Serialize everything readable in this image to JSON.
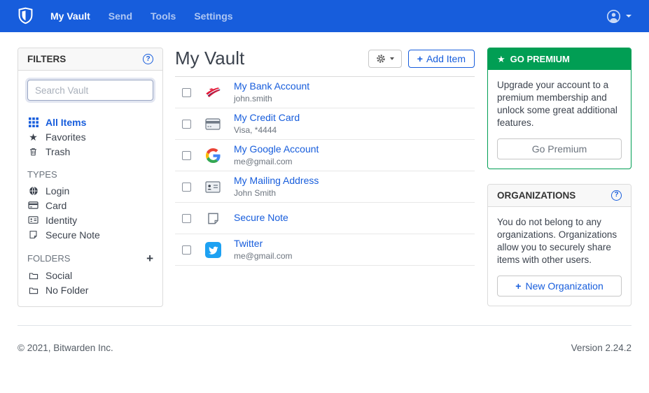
{
  "navbar": {
    "items": [
      {
        "label": "My Vault",
        "active": true
      },
      {
        "label": "Send",
        "active": false
      },
      {
        "label": "Tools",
        "active": false
      },
      {
        "label": "Settings",
        "active": false
      }
    ]
  },
  "icons": {
    "plus": "+",
    "star": "★",
    "question_mark": "?"
  },
  "filters": {
    "title": "FILTERS",
    "search_placeholder": "Search Vault",
    "items": [
      {
        "label": "All Items",
        "active": true
      },
      {
        "label": "Favorites",
        "active": false
      },
      {
        "label": "Trash",
        "active": false
      }
    ],
    "types_heading": "TYPES",
    "types": [
      {
        "label": "Login"
      },
      {
        "label": "Card"
      },
      {
        "label": "Identity"
      },
      {
        "label": "Secure Note"
      }
    ],
    "folders_heading": "FOLDERS",
    "folders": [
      {
        "label": "Social"
      },
      {
        "label": "No Folder"
      }
    ]
  },
  "vault": {
    "title": "My Vault",
    "add_item_label": "Add Item",
    "items": [
      {
        "title": "My Bank Account",
        "subtitle": "john.smith",
        "icon": "bank-of-america"
      },
      {
        "title": "My Credit Card",
        "subtitle": "Visa, *4444",
        "icon": "credit-card"
      },
      {
        "title": "My Google Account",
        "subtitle": "me@gmail.com",
        "icon": "google"
      },
      {
        "title": "My Mailing Address",
        "subtitle": "John Smith",
        "icon": "identity-card"
      },
      {
        "title": "Secure Note",
        "subtitle": "",
        "icon": "secure-note"
      },
      {
        "title": "Twitter",
        "subtitle": "me@gmail.com",
        "icon": "twitter"
      }
    ]
  },
  "premium": {
    "title": "GO PREMIUM",
    "body": "Upgrade your account to a premium membership and unlock some great additional features.",
    "button_label": "Go Premium"
  },
  "organizations": {
    "title": "ORGANIZATIONS",
    "body": "You do not belong to any organizations. Organizations allow you to securely share items with other users.",
    "button_label": "New Organization"
  },
  "footer": {
    "copyright": "© 2021, Bitwarden Inc.",
    "version": "Version 2.24.2"
  },
  "colors": {
    "brand_blue": "#175ddc",
    "premium_green": "#019e54",
    "twitter_blue": "#1da1f2"
  }
}
